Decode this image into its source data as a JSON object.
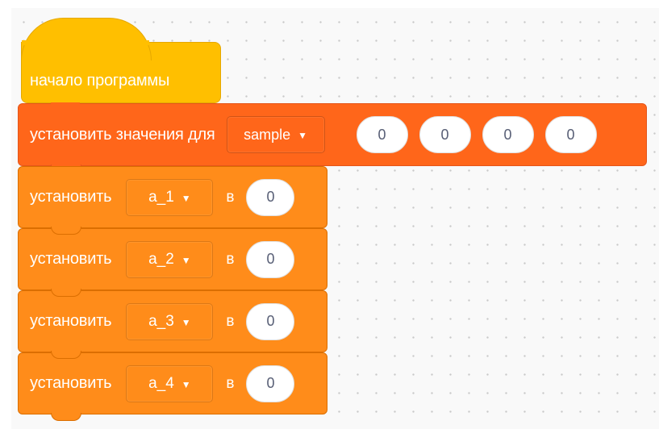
{
  "hat_block": {
    "label": "начало программы",
    "color": "#ffbf00"
  },
  "set_values_block": {
    "label": "установить значения для",
    "list_dropdown": "sample",
    "values": [
      "0",
      "0",
      "0",
      "0"
    ],
    "color": "#ff661a"
  },
  "set_var_blocks": [
    {
      "label": "установить",
      "variable": "a_1",
      "to_word": "в",
      "value": "0"
    },
    {
      "label": "установить",
      "variable": "a_2",
      "to_word": "в",
      "value": "0"
    },
    {
      "label": "установить",
      "variable": "a_3",
      "to_word": "в",
      "value": "0"
    },
    {
      "label": "установить",
      "variable": "a_4",
      "to_word": "в",
      "value": "0"
    }
  ],
  "dropdown_icon": "caret-down-icon",
  "variable_block_color": "#ff8c1a",
  "workspace_background": "dotted-grid"
}
